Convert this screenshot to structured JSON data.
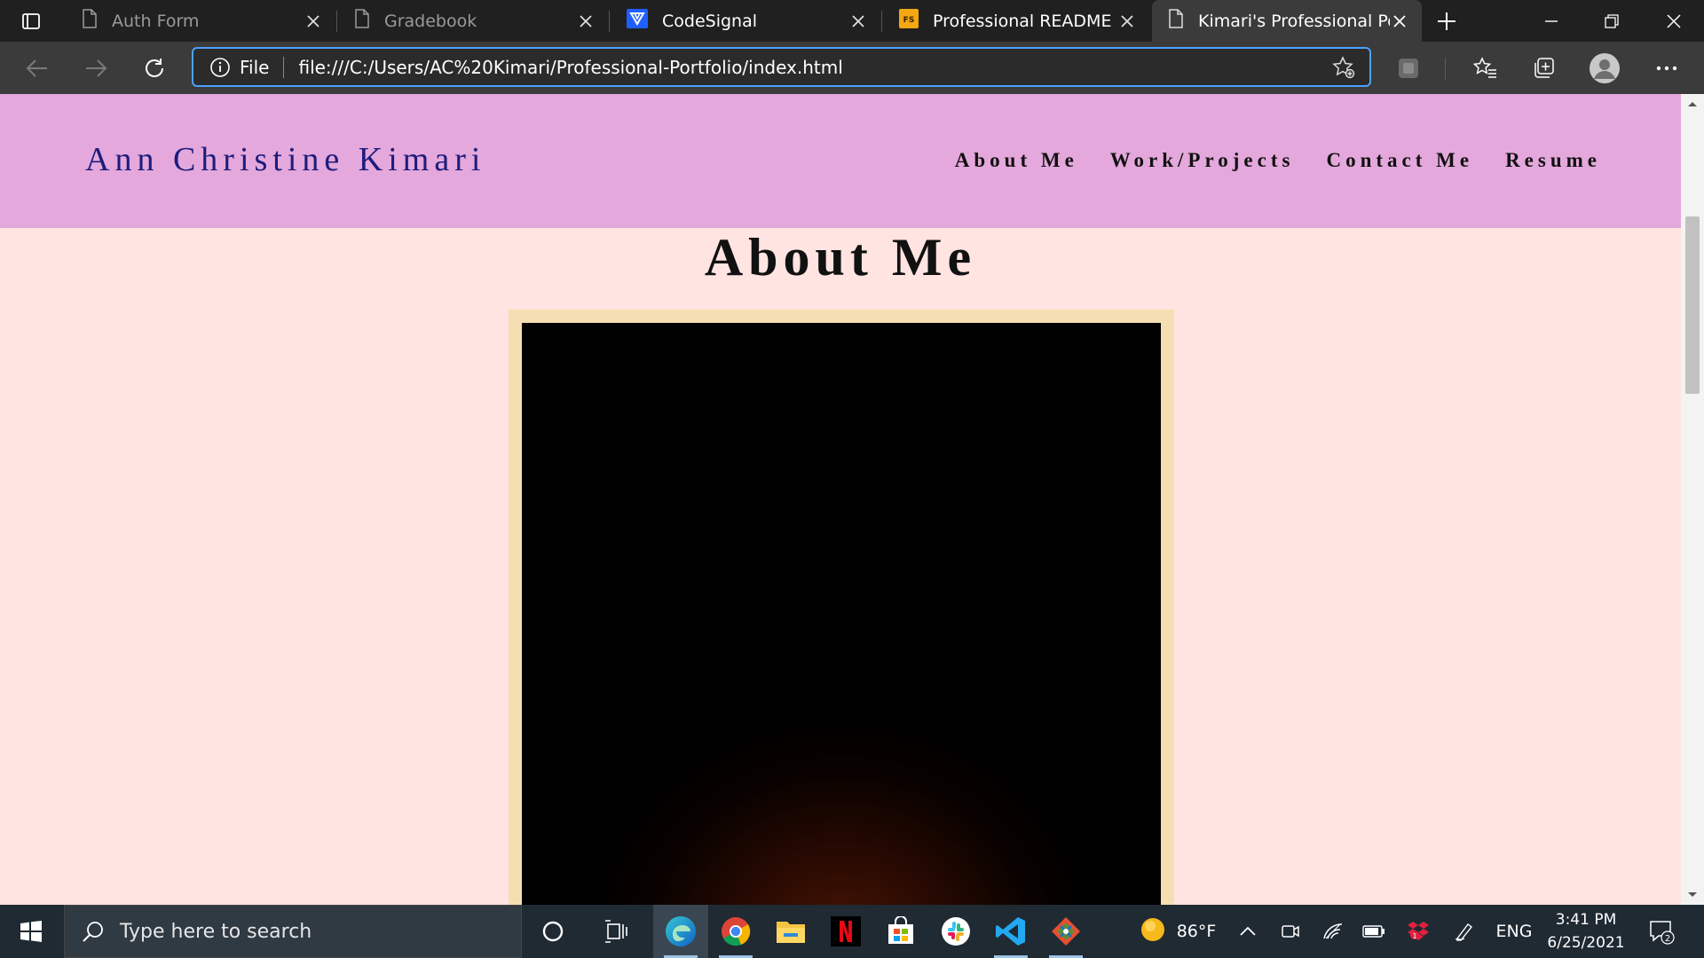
{
  "browser": {
    "tabs": [
      {
        "title": "Auth Form",
        "icon": "page-icon",
        "state": "inactive"
      },
      {
        "title": "Gradebook",
        "icon": "page-icon",
        "state": "inactive"
      },
      {
        "title": "CodeSignal",
        "icon": "codesignal-icon",
        "state": "inactive"
      },
      {
        "title": "Professional README Gui",
        "icon": "fs-icon",
        "state": "inactive"
      },
      {
        "title": "Kimari's Professional Portf",
        "icon": "page-icon",
        "state": "active"
      }
    ],
    "address": {
      "scheme_label": "File",
      "url": "file:///C:/Users/AC%20Kimari/Professional-Portfolio/index.html"
    },
    "colors": {
      "focus_ring": "#4aa3ff",
      "toolbar_bg": "#3b3b3b",
      "tabstrip_bg": "#202020"
    }
  },
  "page": {
    "site_name": "Ann Christine Kimari",
    "nav": [
      "About Me",
      "Work/Projects",
      "Contact Me",
      "Resume"
    ],
    "section_title": "About Me",
    "colors": {
      "header_bg": "#e4a8dc",
      "page_bg": "#ffe4e1",
      "frame": "#f6deb3",
      "site_name": "#1c1c7c"
    }
  },
  "taskbar": {
    "search_placeholder": "Type here to search",
    "apps": [
      "cortana-icon",
      "task-view-icon",
      "edge-icon",
      "chrome-icon",
      "file-explorer-icon",
      "netflix-icon",
      "store-icon",
      "slack-icon",
      "vscode-icon",
      "git-icon"
    ],
    "weather": {
      "temp": "86°F",
      "icon": "sun-icon"
    },
    "language": "ENG",
    "time": "3:41 PM",
    "date": "6/25/2021",
    "notification_count": "2"
  }
}
